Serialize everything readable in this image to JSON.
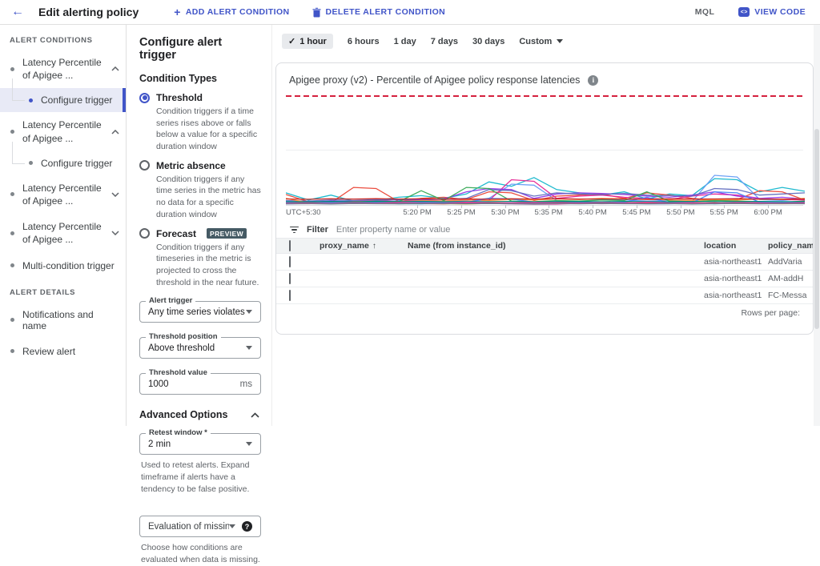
{
  "header": {
    "title": "Edit alerting policy",
    "add_condition": "ADD ALERT CONDITION",
    "delete_condition": "DELETE ALERT CONDITION",
    "mql": "MQL",
    "view_code": "VIEW CODE"
  },
  "icons": {
    "back_arrow": "←",
    "add": "+",
    "check": "✓",
    "sort_ascending": "↑",
    "info": "i",
    "help": "?",
    "view_code": "<>"
  },
  "sidebar": {
    "conditions_label": "ALERT CONDITIONS",
    "details_label": "ALERT DETAILS",
    "conditions": [
      {
        "label": "Latency Percentile of Apigee ...",
        "expanded": true,
        "child": "Configure trigger",
        "child_selected": true
      },
      {
        "label": "Latency Percentile of Apigee ...",
        "expanded": true,
        "child": "Configure trigger",
        "child_selected": false
      },
      {
        "label": "Latency Percentile of Apigee ...",
        "expanded": false
      },
      {
        "label": "Latency Percentile of Apigee ...",
        "expanded": false
      },
      {
        "label": "Multi-condition trigger"
      }
    ],
    "details": [
      {
        "label": "Notifications and name"
      },
      {
        "label": "Review alert"
      }
    ]
  },
  "panel": {
    "title": "Configure alert trigger",
    "condition_types_label": "Condition Types",
    "condition_types": [
      {
        "name": "Threshold",
        "selected": true,
        "desc": "Condition triggers if a time series rises above or falls below a value for a specific duration window"
      },
      {
        "name": "Metric absence",
        "selected": false,
        "desc": "Condition triggers if any time series in the metric has no data for a specific duration window"
      },
      {
        "name": "Forecast",
        "selected": false,
        "badge": "PREVIEW",
        "desc": "Condition triggers if any timeseries in the metric is projected to cross the threshold in the near future."
      }
    ],
    "alert_trigger": {
      "label": "Alert trigger",
      "value": "Any time series violates"
    },
    "threshold_position": {
      "label": "Threshold position",
      "value": "Above threshold"
    },
    "threshold_value": {
      "label": "Threshold value",
      "value": "1000",
      "suffix": "ms"
    },
    "advanced_label": "Advanced Options",
    "retest_window": {
      "label": "Retest window *",
      "value": "2 min",
      "helper": "Used to retest alerts. Expand timeframe if alerts have a tendency to be false positive."
    },
    "missing_data": {
      "value": "Evaluation of missing data",
      "helper": "Choose how conditions are evaluated when data is missing."
    }
  },
  "timebar": {
    "options": [
      "1 hour",
      "6 hours",
      "1 day",
      "7 days",
      "30 days"
    ],
    "selected": "1 hour",
    "custom_label": "Custom"
  },
  "chart_data": {
    "type": "line",
    "title": "Apigee proxy (v2) - Percentile of Apigee policy response latencies",
    "threshold": {
      "value": 1000,
      "unit": "ms",
      "style": "dashed",
      "color": "#d5213e"
    },
    "x_axis": {
      "timezone_label": "UTC+5:30",
      "ticks": [
        "5:20 PM",
        "5:25 PM",
        "5:30 PM",
        "5:35 PM",
        "5:40 PM",
        "5:45 PM",
        "5:50 PM",
        "5:55 PM",
        "6:00 PM"
      ]
    },
    "y_axis": {
      "min": 0,
      "visible_max": 1000,
      "unit": "ms",
      "gridlines_ms": [
        500
      ]
    },
    "series": [
      {
        "color": "#12b5cb",
        "values": [
          110,
          45,
          90,
          35,
          40,
          70,
          85,
          60,
          100,
          210,
          170,
          250,
          140,
          110,
          90,
          120,
          55,
          100,
          85,
          240,
          230,
          120,
          160,
          125
        ]
      },
      {
        "color": "#669df6",
        "values": [
          20,
          15,
          25,
          30,
          20,
          35,
          30,
          25,
          40,
          60,
          190,
          180,
          40,
          30,
          50,
          45,
          35,
          40,
          30,
          270,
          255,
          50,
          40,
          60
        ]
      },
      {
        "color": "#ea4335",
        "values": [
          95,
          30,
          20,
          160,
          150,
          30,
          60,
          70,
          50,
          120,
          110,
          40,
          80,
          90,
          100,
          60,
          110,
          90,
          60,
          40,
          50,
          130,
          120,
          45
        ]
      },
      {
        "color": "#e52592",
        "values": [
          25,
          30,
          20,
          35,
          40,
          30,
          45,
          35,
          50,
          40,
          230,
          215,
          60,
          80,
          90,
          70,
          60,
          50,
          80,
          100,
          90,
          60,
          50,
          45
        ]
      },
      {
        "color": "#9334e6",
        "values": [
          30,
          25,
          35,
          30,
          40,
          50,
          45,
          55,
          120,
          150,
          140,
          60,
          100,
          110,
          105,
          95,
          80,
          70,
          90,
          120,
          80,
          60,
          70,
          55
        ]
      },
      {
        "color": "#5e6abf",
        "values": [
          40,
          35,
          45,
          40,
          50,
          45,
          55,
          50,
          60,
          140,
          130,
          80,
          110,
          100,
          95,
          105,
          90,
          85,
          80,
          150,
          140,
          90,
          100,
          110
        ]
      },
      {
        "color": "#fa903e",
        "values": [
          60,
          20,
          25,
          30,
          35,
          30,
          40,
          35,
          45,
          40,
          50,
          45,
          55,
          50,
          60,
          55,
          50,
          45,
          40,
          50,
          45,
          55,
          50,
          60
        ]
      },
      {
        "color": "#34a853",
        "values": [
          25,
          20,
          30,
          25,
          35,
          30,
          130,
          40,
          160,
          150,
          35,
          30,
          40,
          35,
          45,
          40,
          120,
          35,
          30,
          40,
          35,
          30,
          25,
          35
        ]
      },
      {
        "color": "#4285f4",
        "values": [
          20,
          18,
          22,
          19,
          25,
          21,
          24,
          20,
          23,
          60,
          55,
          25,
          30,
          28,
          26,
          24,
          70,
          22,
          20,
          120,
          110,
          25,
          22,
          20
        ]
      },
      {
        "color": "#c5221f",
        "values": [
          55,
          52,
          56,
          53,
          57,
          54,
          56,
          53,
          55,
          52,
          56,
          54,
          57,
          53,
          55,
          54,
          52,
          56,
          53,
          55,
          57,
          52,
          54,
          53
        ]
      },
      {
        "color": "#00897b",
        "values": [
          30,
          28,
          32,
          29,
          31,
          30,
          33,
          29,
          31,
          30,
          32,
          28,
          30,
          31,
          29,
          32,
          30,
          28,
          31,
          30,
          29,
          32,
          30,
          29
        ]
      },
      {
        "color": "#f538a0",
        "values": [
          15,
          18,
          14,
          20,
          16,
          22,
          18,
          15,
          24,
          20,
          17,
          22,
          19,
          16,
          21,
          18,
          23,
          17,
          20,
          15,
          22,
          18,
          16,
          20
        ]
      },
      {
        "color": "#607d8b",
        "values": [
          10,
          12,
          9,
          13,
          11,
          10,
          14,
          12,
          10,
          13,
          11,
          9,
          12,
          10,
          13,
          11,
          10,
          12,
          9,
          11,
          13,
          10,
          12,
          11
        ]
      }
    ],
    "background_band": {
      "count": 10,
      "max_value_ms": 26,
      "colors": [
        "#ea4335",
        "#4285f4",
        "#fbbc04",
        "#34a853",
        "#9334e6",
        "#e52592",
        "#12b5cb",
        "#fa903e",
        "#5e6abf",
        "#c5221f"
      ]
    }
  },
  "filter": {
    "label": "Filter",
    "placeholder": "Enter property name or value"
  },
  "table": {
    "columns": {
      "proxy_name": "proxy_name",
      "instance_name": "Name (from instance_id)",
      "location": "location",
      "policy_name": "policy_name"
    },
    "rows": [
      {
        "marker_shape": "square",
        "marker_color": "#12b5cb",
        "proxy_name": "",
        "instance_name": "",
        "location": "asia-northeast1",
        "policy_name": "AddVaria"
      },
      {
        "marker_shape": "circle",
        "marker_color": "#4285f4",
        "proxy_name": "",
        "instance_name": "",
        "location": "asia-northeast1",
        "policy_name": "AM-addH"
      },
      {
        "marker_shape": "diamond",
        "marker_color": "#e52592",
        "proxy_name": "",
        "instance_name": "",
        "location": "asia-northeast1",
        "policy_name": "FC-Messa"
      }
    ],
    "footer": {
      "rows_per_page": "Rows per page:"
    }
  },
  "colors": {
    "accent": "#4155c8",
    "threshold_red": "#d5213e",
    "selected_bg": "#e8eaf6",
    "header_gray": "#f1f3f4"
  }
}
